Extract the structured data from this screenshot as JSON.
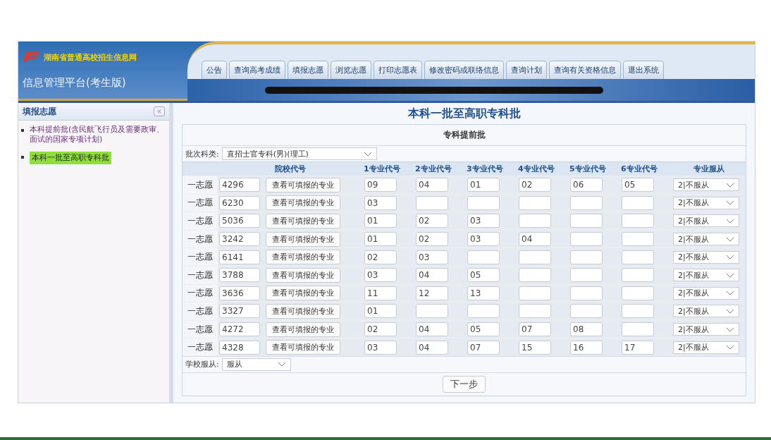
{
  "header": {
    "logo_text": "湖南省普通高校招生信息网",
    "platform": "信息管理平台(考生版)"
  },
  "tabs": [
    {
      "label": "公告"
    },
    {
      "label": "查询高考成绩"
    },
    {
      "label": "填报志愿"
    },
    {
      "label": "浏览志愿"
    },
    {
      "label": "打印志愿表"
    },
    {
      "label": "修改密码或联络信息"
    },
    {
      "label": "查询计划"
    },
    {
      "label": "查询有关资格信息"
    },
    {
      "label": "退出系统"
    }
  ],
  "sidebar": {
    "title": "填报志愿",
    "items": [
      {
        "label": "本科提前批(含民航飞行员及需要政审、面试的国家专项计划)",
        "selected": false
      },
      {
        "label": "本科一批至高职专科批",
        "selected": true
      }
    ]
  },
  "main": {
    "title": "本科一批至高职专科批",
    "subtitle": "专科提前批",
    "batch_label": "批次科类:",
    "batch_value": "直招士官专科(男)(理工)",
    "columns": [
      "院校代号",
      "1专业代号",
      "2专业代号",
      "3专业代号",
      "4专业代号",
      "5专业代号",
      "6专业代号",
      "专业服从"
    ],
    "rows": [
      {
        "choice": "一志愿",
        "school_code": "4296",
        "button": "查看可填报的专业",
        "codes": [
          "09",
          "04",
          "01",
          "02",
          "06",
          "05"
        ],
        "obey": "2|不服从"
      },
      {
        "choice": "一志愿",
        "school_code": "6230",
        "button": "查看可填报的专业",
        "codes": [
          "03"
        ],
        "obey": "2|不服从"
      },
      {
        "choice": "一志愿",
        "school_code": "5036",
        "button": "查看可填报的专业",
        "codes": [
          "01",
          "02",
          "03"
        ],
        "obey": "2|不服从"
      },
      {
        "choice": "一志愿",
        "school_code": "3242",
        "button": "查看可填报的专业",
        "codes": [
          "01",
          "02",
          "03",
          "04"
        ],
        "obey": "2|不服从"
      },
      {
        "choice": "一志愿",
        "school_code": "6141",
        "button": "查看可填报的专业",
        "codes": [
          "02",
          "03"
        ],
        "obey": "2|不服从"
      },
      {
        "choice": "一志愿",
        "school_code": "3788",
        "button": "查看可填报的专业",
        "codes": [
          "03",
          "04",
          "05"
        ],
        "obey": "2|不服从"
      },
      {
        "choice": "一志愿",
        "school_code": "3636",
        "button": "查看可填报的专业",
        "codes": [
          "11",
          "12",
          "13"
        ],
        "obey": "2|不服从"
      },
      {
        "choice": "一志愿",
        "school_code": "3327",
        "button": "查看可填报的专业",
        "codes": [
          "01"
        ],
        "obey": "2|不服从"
      },
      {
        "choice": "一志愿",
        "school_code": "4272",
        "button": "查看可填报的专业",
        "codes": [
          "02",
          "04",
          "05",
          "07",
          "08"
        ],
        "obey": "2|不服从"
      },
      {
        "choice": "一志愿",
        "school_code": "4328",
        "button": "查看可填报的专业",
        "codes": [
          "03",
          "04",
          "07",
          "15",
          "16",
          "17"
        ],
        "obey": "2|不服从"
      }
    ],
    "school_obey_label": "学校服从:",
    "school_obey_value": "服从",
    "next_button": "下一步"
  }
}
